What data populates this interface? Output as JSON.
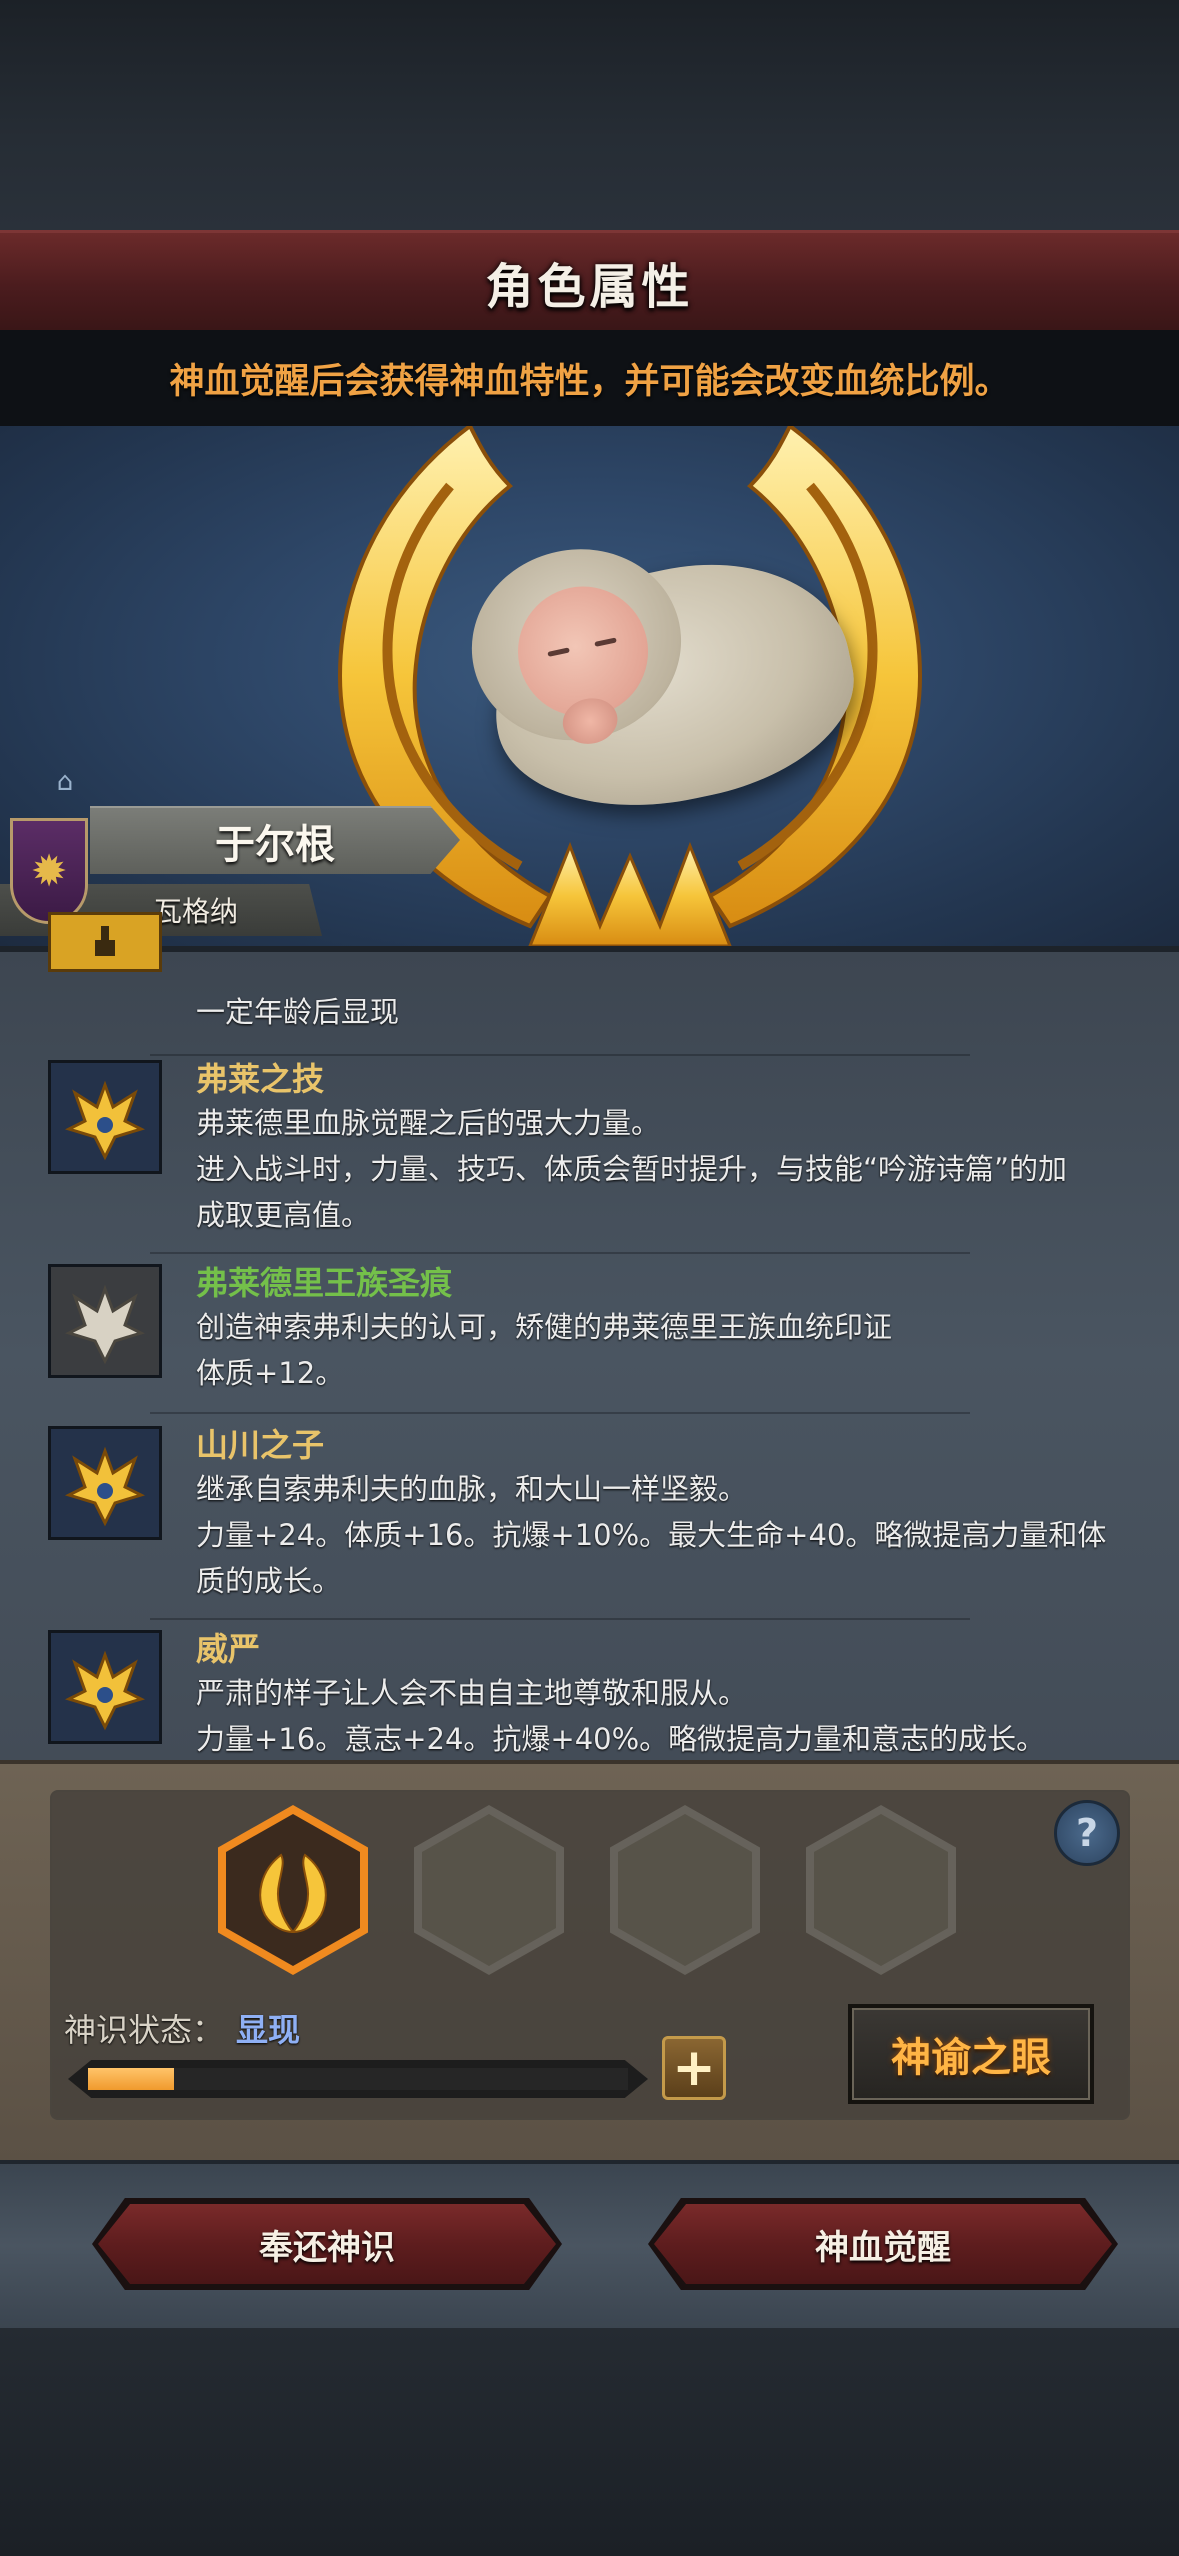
{
  "header": {
    "title": "角色属性",
    "hint": "神血觉醒后会获得神血特性，并可能会改变血统比例。"
  },
  "character": {
    "name": "于尔根",
    "house": "瓦格纳"
  },
  "traits": [
    {
      "name": "",
      "lines": [
        "一定年龄后显现"
      ],
      "icon": "locked-trait-icon"
    },
    {
      "name": "弗莱之技",
      "name_color": "#e9c46a",
      "lines": [
        "弗莱德里血脉觉醒之后的强大力量。",
        "进入战斗时，力量、技巧、体质会暂时提升，与技能“吟游诗篇”的加",
        "成取更高值。"
      ],
      "icon": "golden-crest-icon"
    },
    {
      "name": "弗莱德里王族圣痕",
      "name_color": "#74c04a",
      "lines": [
        "创造神索弗利夫的认可，矫健的弗莱德里王族血统印证",
        "体质+12。"
      ],
      "icon": "silver-crest-icon"
    },
    {
      "name": "山川之子",
      "name_color": "#e9c46a",
      "lines": [
        "继承自索弗利夫的血脉，和大山一样坚毅。",
        "力量+24。体质+16。抗爆+10%。最大生命+40。略微提高力量和体",
        "质的成长。"
      ],
      "icon": "golden-crest-icon"
    },
    {
      "name": "威严",
      "name_color": "#e9c46a",
      "lines": [
        "严肃的样子让人会不由自主地尊敬和服从。",
        "力量+16。意志+24。抗爆+40%。略微提高力量和意志的成长。"
      ],
      "icon": "golden-crest-icon"
    }
  ],
  "divine_sense": {
    "label": "神识状态：",
    "value": "显现",
    "progress": 0.16,
    "plus": "+",
    "help": "?",
    "oracle_button": "神谕之眼"
  },
  "actions": {
    "return_button": "奉还神识",
    "awaken_button": "神血觉醒"
  },
  "colors": {
    "accent_orange": "#f0a244",
    "banner_red": "#5e1d1e",
    "state_blue": "#8fb0f5"
  }
}
